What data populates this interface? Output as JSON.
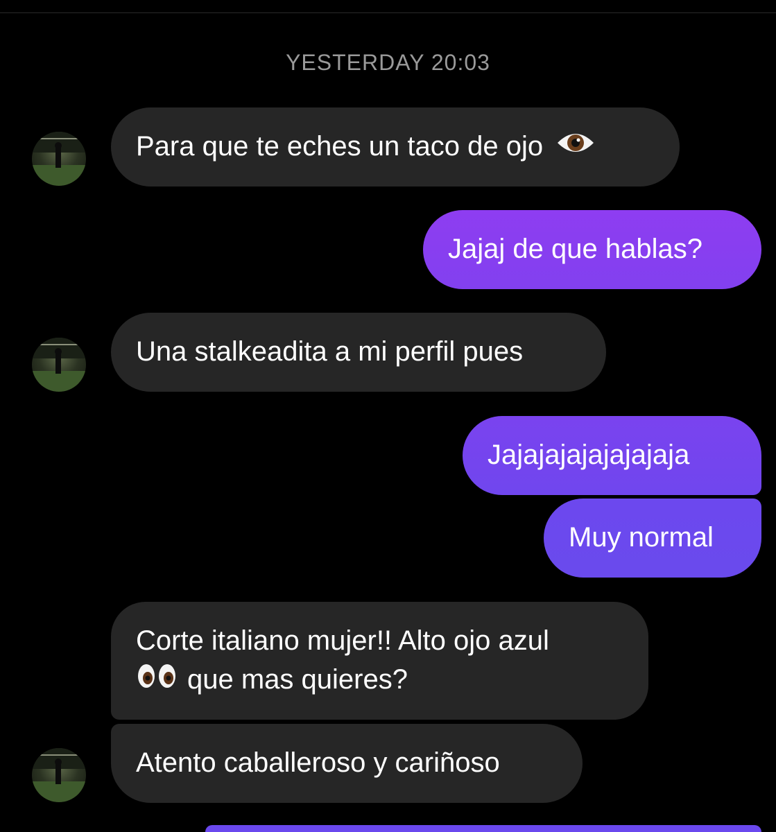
{
  "conversation": {
    "timestamp": "YESTERDAY 20:03",
    "messages": [
      {
        "from": "them",
        "text": "Para que te eches un taco de ojo",
        "emoji": "eye-icon"
      },
      {
        "from": "me",
        "text": "Jajaj de que hablas?"
      },
      {
        "from": "them",
        "text": "Una stalkeadita a mi perfil pues"
      },
      {
        "from": "me",
        "text": "Jajajajajajajajaja"
      },
      {
        "from": "me",
        "text": "Muy normal"
      },
      {
        "from": "them",
        "text_line1": "Corte italiano mujer!! Alto ojo azul",
        "text_line2": "que mas quieres?",
        "emoji": "eyes-icon"
      },
      {
        "from": "them",
        "text": "Atento caballeroso y cariñoso"
      }
    ]
  },
  "colors": {
    "background": "#000000",
    "received_bubble": "#262626",
    "sent_bubble_top": "#8b3ff0",
    "sent_bubble_bottom": "#6a48ee",
    "timestamp_text": "#9a9a9a"
  }
}
